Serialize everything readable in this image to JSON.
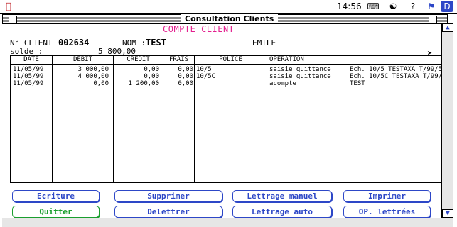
{
  "menubar": {
    "apple_icon": "apple-icon",
    "clock": "14:56",
    "icons": [
      "keyboard-icon",
      "share-icon",
      "help-icon",
      "flag-icon",
      "app-icon"
    ]
  },
  "window": {
    "title": "Consultation Clients"
  },
  "heading": "COMPTE CLIENT",
  "client": {
    "num_label": "N° CLIENT",
    "num_value": "002634",
    "nom_label": "NOM :",
    "nom_value": "TEST",
    "prenom": "EMILE",
    "solde_label": "solde :",
    "solde_value": "5 800,00"
  },
  "table": {
    "columns": [
      "DATE",
      "DEBIT",
      "CREDIT",
      "FRAIS",
      "POLICE",
      "OPERATION"
    ],
    "rows": [
      {
        "date": "11/05/99",
        "debit": "3 000,00",
        "credit": "0,00",
        "frais": "0,00",
        "police": "10/5",
        "operation": "saisie quittance",
        "detail": "Ech. 10/5 TESTAXA T/99/5"
      },
      {
        "date": "11/05/99",
        "debit": "4 000,00",
        "credit": "0,00",
        "frais": "0,00",
        "police": "10/5C",
        "operation": "saisie quittance",
        "detail": "Ech. 10/5C TESTAXA T/99/"
      },
      {
        "date": "11/05/99",
        "debit": "0,00",
        "credit": "1 200,00",
        "frais": "0,00",
        "police": "",
        "operation": "acompte",
        "detail": "TEST"
      }
    ]
  },
  "buttons": {
    "ecriture": "Ecriture",
    "supprimer": "Supprimer",
    "lettrage_manuel": "Lettrage manuel",
    "imprimer": "Imprimer",
    "quitter": "Quitter",
    "delettrer": "Delettrer",
    "lettrage_auto": "Lettrage auto",
    "op_lettrees": "OP. lettrées"
  },
  "colors": {
    "heading": "#e4208f",
    "button": "#2d47c7",
    "quit_button": "#1a9e2e"
  }
}
